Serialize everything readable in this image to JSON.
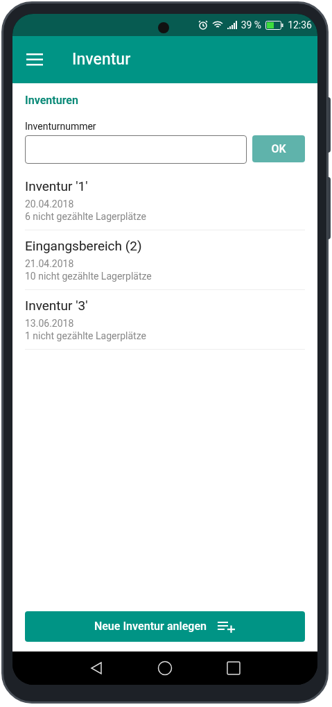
{
  "status_bar": {
    "battery": "39 %",
    "time": "12:36"
  },
  "app_bar": {
    "title": "Inventur"
  },
  "section_title": "Inventuren",
  "number_field": {
    "label": "Inventurnummer",
    "ok_button": {
      "label": "OK",
      "disabled": true
    }
  },
  "inventories": [
    {
      "name": "Inventur '1'",
      "date": "20.04.2018",
      "uncounted": "6 nicht gezählte Lagerplätze"
    },
    {
      "name": "Eingangsbereich (2)",
      "date": "21.04.2018",
      "uncounted": "10 nicht gezählte Lagerplätze"
    },
    {
      "name": "Inventur '3'",
      "date": "13.06.2018",
      "uncounted": "1 nicht gezählte Lagerplätze"
    }
  ],
  "new_button": {
    "label": "Neue Inventur anlegen"
  }
}
